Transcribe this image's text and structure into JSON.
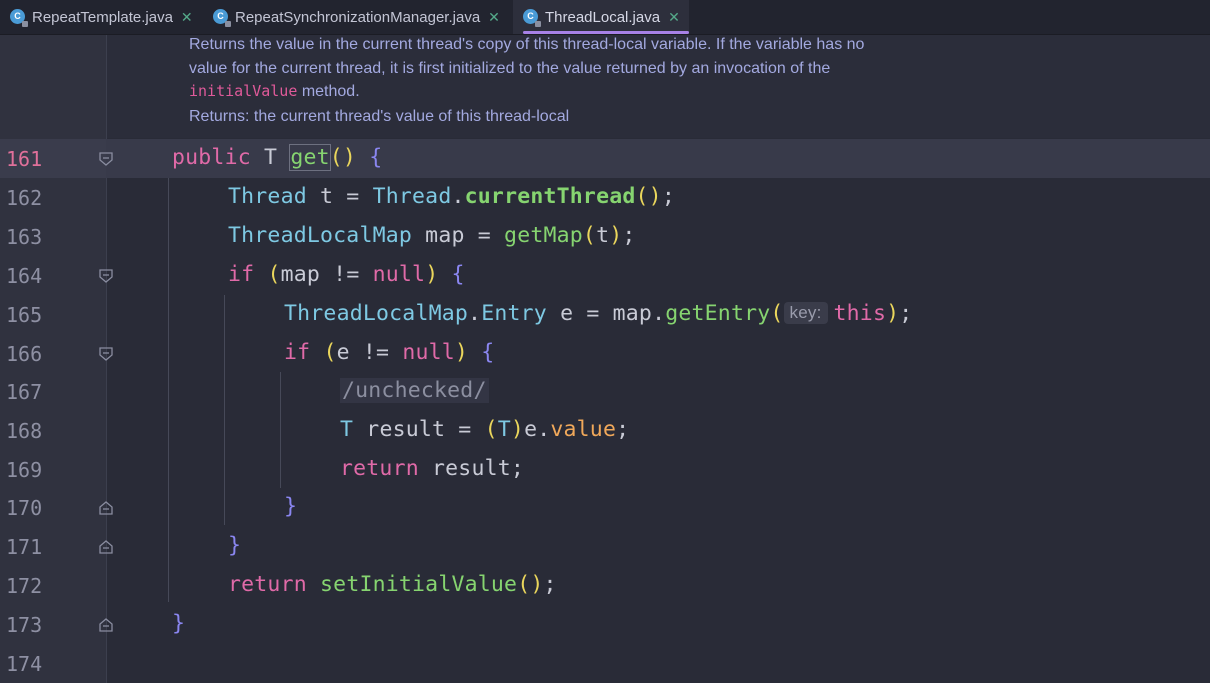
{
  "tabs": [
    {
      "label": "RepeatTemplate.java",
      "active": false
    },
    {
      "label": "RepeatSynchronizationManager.java",
      "active": false
    },
    {
      "label": "ThreadLocal.java",
      "active": true
    }
  ],
  "doc": {
    "line1": "Returns the value in the current thread's copy of this thread-local variable. If the variable has no",
    "line2": "value for the current thread, it is first initialized to the value returned by an invocation of the",
    "code_ref": "initialValue",
    "method_word": " method.",
    "returns": "Returns: the current thread's value of this thread-local"
  },
  "lines": [
    {
      "num": "161"
    },
    {
      "num": "162"
    },
    {
      "num": "163"
    },
    {
      "num": "164"
    },
    {
      "num": "165"
    },
    {
      "num": "166"
    },
    {
      "num": "167"
    },
    {
      "num": "168"
    },
    {
      "num": "169"
    },
    {
      "num": "170"
    },
    {
      "num": "171"
    },
    {
      "num": "172"
    },
    {
      "num": "173"
    },
    {
      "num": "174"
    }
  ],
  "tokens": {
    "l161": [
      "public",
      " T ",
      "get",
      "()",
      " {"
    ],
    "l162": [
      "Thread",
      " t = ",
      "Thread",
      ".",
      "currentThread",
      "()",
      ";"
    ],
    "l163": [
      "ThreadLocalMap",
      " map = ",
      "getMap",
      "(",
      "t",
      ")",
      ";"
    ],
    "l164": [
      "if",
      " ",
      "(",
      "map != ",
      "null",
      ")",
      " {"
    ],
    "l165": [
      "ThreadLocalMap",
      ".",
      "Entry",
      " e = map.",
      "getEntry",
      "(",
      "key:",
      "this",
      ")",
      ";"
    ],
    "l166": [
      "if",
      " ",
      "(",
      "e != ",
      "null",
      ")",
      " {"
    ],
    "l167": [
      "/unchecked/"
    ],
    "l168": [
      "T",
      " result = ",
      "(",
      "T",
      ")",
      "e.",
      "value",
      ";"
    ],
    "l169": [
      "return",
      " result;"
    ],
    "l170": [
      "}"
    ],
    "l171": [
      "}"
    ],
    "l172": [
      "return",
      " ",
      "setInitialValue",
      "()",
      ";"
    ],
    "l173": [
      "}"
    ]
  },
  "current_line": "161"
}
